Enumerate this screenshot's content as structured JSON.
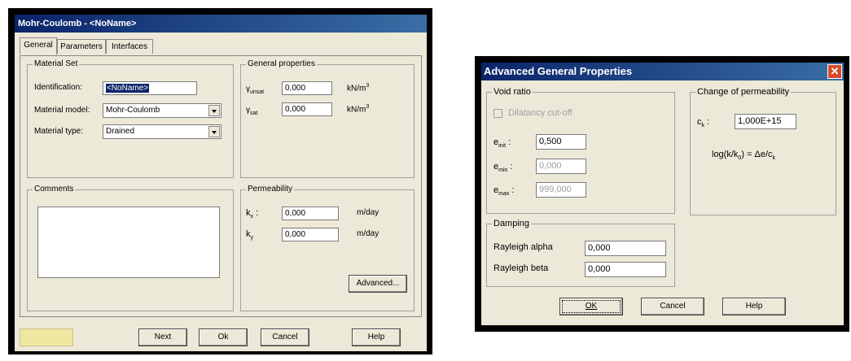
{
  "dialog1": {
    "title": "Mohr-Coulomb - <NoName>",
    "tabs": [
      "General",
      "Parameters",
      "Interfaces"
    ],
    "material_set": {
      "legend": "Material Set",
      "identification_label": "Identification:",
      "identification_value": "<NoName>",
      "model_label": "Material model:",
      "model_value": "Mohr-Coulomb",
      "type_label": "Material type:",
      "type_value": "Drained"
    },
    "general_properties": {
      "legend": "General properties",
      "gamma_unsat_label": "γ",
      "gamma_unsat_sub": "unsat",
      "gamma_unsat_value": "0,000",
      "gamma_unsat_unit": "kN/m",
      "gamma_sat_label": "γ",
      "gamma_sat_sub": "sat",
      "gamma_sat_value": "0,000",
      "gamma_sat_unit": "kN/m",
      "unit_exp": "3"
    },
    "comments": {
      "legend": "Comments"
    },
    "permeability": {
      "legend": "Permeability",
      "kx_label": "k",
      "kx_sub": "x",
      "kx_colon": ":",
      "kx_value": "0,000",
      "kx_unit": "m/day",
      "ky_label": "k",
      "ky_sub": "y",
      "ky_colon": ":",
      "ky_value": "0,000",
      "ky_unit": "m/day",
      "advanced_button": "Advanced..."
    },
    "buttons": {
      "next": "Next",
      "ok": "Ok",
      "cancel": "Cancel",
      "help": "Help"
    }
  },
  "dialog2": {
    "title": "Advanced General Properties",
    "close_glyph": "✕",
    "void_ratio": {
      "legend": "Void ratio",
      "dilatancy_label": "Dilatancy cut-off",
      "dilatancy_checked": false,
      "e_init_label": "e",
      "e_init_sub": "init",
      "e_init_value": "0,500",
      "e_min_label": "e",
      "e_min_sub": "min",
      "e_min_value": "0,000",
      "e_max_label": "e",
      "e_max_sub": "max",
      "e_max_value": "999,000",
      "colon": ":"
    },
    "change_permeability": {
      "legend": "Change of permeability",
      "ck_label": "c",
      "ck_sub": "k",
      "ck_colon": ":",
      "ck_value": "1,000E+15",
      "formula_a": "log(k/k",
      "formula_sub0": "0",
      "formula_b": ") = Δe/c",
      "formula_sub_k": "k"
    },
    "damping": {
      "legend": "Damping",
      "alpha_label": "Rayleigh alpha",
      "alpha_value": "0,000",
      "beta_label": "Rayleigh beta",
      "beta_value": "0,000"
    },
    "buttons": {
      "ok": "OK",
      "cancel": "Cancel",
      "help": "Help"
    }
  }
}
